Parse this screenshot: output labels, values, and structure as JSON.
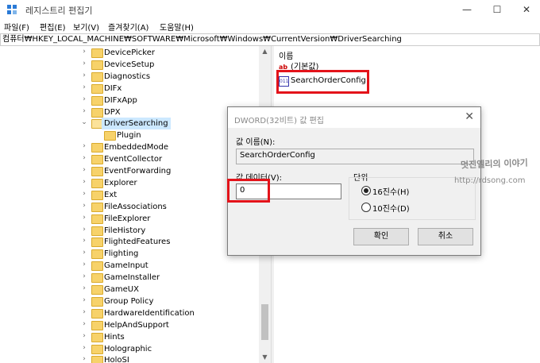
{
  "window": {
    "title": "레지스트리 편집기",
    "minimize": "—",
    "maximize": "☐",
    "close": "✕"
  },
  "menu": [
    "파일(F)",
    "편집(E)",
    "보기(V)",
    "즐겨찾기(A)",
    "도움말(H)"
  ],
  "address": "컴퓨터₩HKEY_LOCAL_MACHINE₩SOFTWARE₩Microsoft₩Windows₩CurrentVersion₩DriverSearching",
  "tree": {
    "items": [
      {
        "label": "DevicePicker",
        "expand": ">"
      },
      {
        "label": "DeviceSetup",
        "expand": ">"
      },
      {
        "label": "Diagnostics",
        "expand": ">"
      },
      {
        "label": "DIFx",
        "expand": ">"
      },
      {
        "label": "DIFxApp",
        "expand": ">"
      },
      {
        "label": "DPX",
        "expand": ">"
      },
      {
        "label": "DriverSearching",
        "expand": "v"
      },
      {
        "label": "Plugin",
        "expand": ""
      },
      {
        "label": "EmbeddedMode",
        "expand": ">"
      },
      {
        "label": "EventCollector",
        "expand": ">"
      },
      {
        "label": "EventForwarding",
        "expand": ">"
      },
      {
        "label": "Explorer",
        "expand": ">"
      },
      {
        "label": "Ext",
        "expand": ">"
      },
      {
        "label": "FileAssociations",
        "expand": ">"
      },
      {
        "label": "FileExplorer",
        "expand": ">"
      },
      {
        "label": "FileHistory",
        "expand": ">"
      },
      {
        "label": "FlightedFeatures",
        "expand": ">"
      },
      {
        "label": "Flighting",
        "expand": ">"
      },
      {
        "label": "GameInput",
        "expand": ">"
      },
      {
        "label": "GameInstaller",
        "expand": ">"
      },
      {
        "label": "GameUX",
        "expand": ">"
      },
      {
        "label": "Group Policy",
        "expand": ">"
      },
      {
        "label": "HardwareIdentification",
        "expand": ">"
      },
      {
        "label": "HelpAndSupport",
        "expand": ">"
      },
      {
        "label": "Hints",
        "expand": ">"
      },
      {
        "label": "Holographic",
        "expand": ">"
      },
      {
        "label": "HoloSI",
        "expand": ">"
      }
    ],
    "scroll_up": "▲",
    "scroll_down": "▼"
  },
  "values": {
    "header_name": "이름",
    "rows": [
      {
        "icon": "string-value-icon",
        "glyph": "ab",
        "name": "(기본값)"
      },
      {
        "icon": "dword-value-icon",
        "glyph": "011",
        "name": "SearchOrderConfig"
      }
    ]
  },
  "dialog": {
    "title": "DWORD(32비트) 값 편집",
    "close": "✕",
    "name_label": "값 이름(N):",
    "name_value": "SearchOrderConfig",
    "data_label": "값 데이터(V):",
    "data_value": "0",
    "base_label": "단위",
    "base_options": [
      {
        "label": "16진수(H)",
        "checked": true
      },
      {
        "label": "10진수(D)",
        "checked": false
      }
    ],
    "ok_label": "확인",
    "cancel_label": "취소"
  },
  "watermark": {
    "line1": "멋진엘리의 이야기",
    "line2": "http://rdsong.com"
  },
  "colors": {
    "highlight_box": "#e3131a",
    "selected_row": "#cce8ff",
    "folder": "#f7d26a"
  }
}
